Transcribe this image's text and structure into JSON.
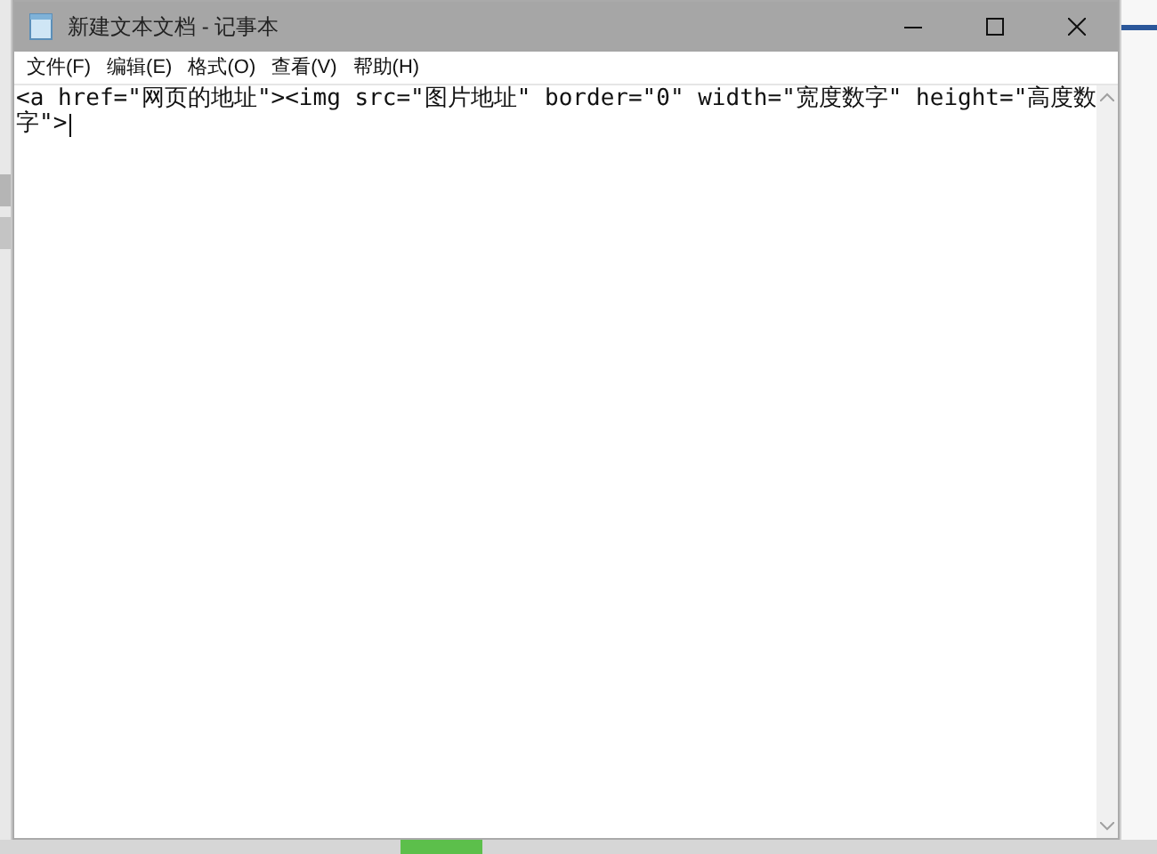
{
  "window": {
    "title": "新建文本文档 - 记事本"
  },
  "menu": [
    {
      "label": "文件(F)"
    },
    {
      "label": "编辑(E)"
    },
    {
      "label": "格式(O)"
    },
    {
      "label": "查看(V)"
    },
    {
      "label": "帮助(H)"
    }
  ],
  "editor": {
    "lines": [
      "<a href=\"网页的地址\"><img src=\"图片地址\" border=\"0\" width=\"宽度数字\" height=\"高度数",
      "字\">"
    ]
  }
}
